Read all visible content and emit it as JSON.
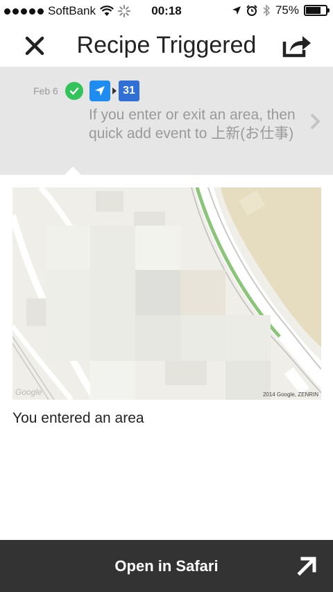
{
  "status_bar": {
    "carrier": "SoftBank",
    "time": "00:18",
    "battery": "75%",
    "battery_level": 0.75
  },
  "header": {
    "title": "Recipe Triggered",
    "close_icon": "close-icon",
    "share_icon": "share-icon"
  },
  "log_entry": {
    "date": "Feb 6",
    "status_icon": "check-circle-icon",
    "trigger_icon": "location-arrow-icon",
    "action_icon": "calendar-icon",
    "calendar_day": "31",
    "description": "If you enter or exit an area, then quick add event to 上新(お仕事)",
    "chevron_icon": "chevron-right-icon"
  },
  "map": {
    "google_label": "Google",
    "attribution": "2014 Google, ZENRIN"
  },
  "caption": "You entered an area",
  "footer": {
    "open_label": "Open in Safari",
    "open_icon": "arrow-up-right-icon"
  },
  "colors": {
    "accent_green": "#34c35a",
    "location_blue": "#1e8cf0",
    "calendar_blue": "#2f6fd6",
    "footer_bg": "#333333"
  }
}
